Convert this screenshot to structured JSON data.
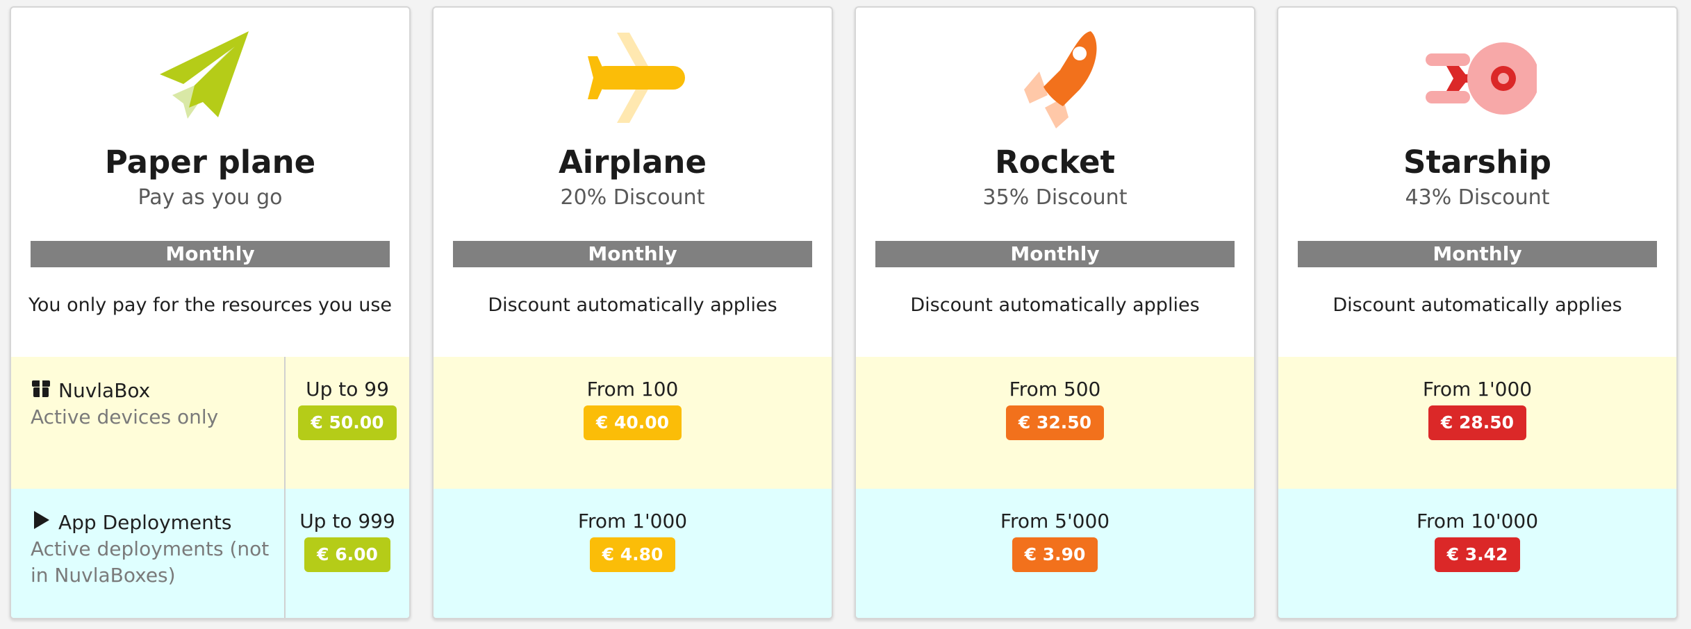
{
  "plans": [
    {
      "name": "Paper plane",
      "subtitle": "Pay as you go",
      "period": "Monthly",
      "description": "You only pay for the resources you use",
      "icon": "paper-plane-icon",
      "accent": "#b5cc18",
      "nuvlabox": {
        "range": "Up to 99",
        "price": "€ 50.00"
      },
      "apps": {
        "range": "Up to 999",
        "price": "€ 6.00"
      }
    },
    {
      "name": "Airplane",
      "subtitle": "20% Discount",
      "period": "Monthly",
      "description": "Discount automatically applies",
      "icon": "airplane-icon",
      "accent": "#fbbd08",
      "nuvlabox": {
        "range": "From 100",
        "price": "€ 40.00"
      },
      "apps": {
        "range": "From 1'000",
        "price": "€ 4.80"
      }
    },
    {
      "name": "Rocket",
      "subtitle": "35% Discount",
      "period": "Monthly",
      "description": "Discount automatically applies",
      "icon": "rocket-icon",
      "accent": "#f2711c",
      "nuvlabox": {
        "range": "From 500",
        "price": "€ 32.50"
      },
      "apps": {
        "range": "From 5'000",
        "price": "€ 3.90"
      }
    },
    {
      "name": "Starship",
      "subtitle": "43% Discount",
      "period": "Monthly",
      "description": "Discount automatically applies",
      "icon": "starship-icon",
      "accent": "#db2828",
      "nuvlabox": {
        "range": "From 1'000",
        "price": "€ 28.50"
      },
      "apps": {
        "range": "From 10'000",
        "price": "€ 3.42"
      }
    }
  ],
  "resources": {
    "nuvlabox": {
      "title": "NuvlaBox",
      "description": "Active devices only",
      "icon": "box-icon"
    },
    "apps": {
      "title": "App Deployments",
      "description": "Active deployments (not in NuvlaBoxes)",
      "icon": "play-icon"
    }
  },
  "colors": {
    "nuvlabox_row_bg": "#fffdd9",
    "apps_row_bg": "#dfffff",
    "period_bar_bg": "#808080"
  }
}
